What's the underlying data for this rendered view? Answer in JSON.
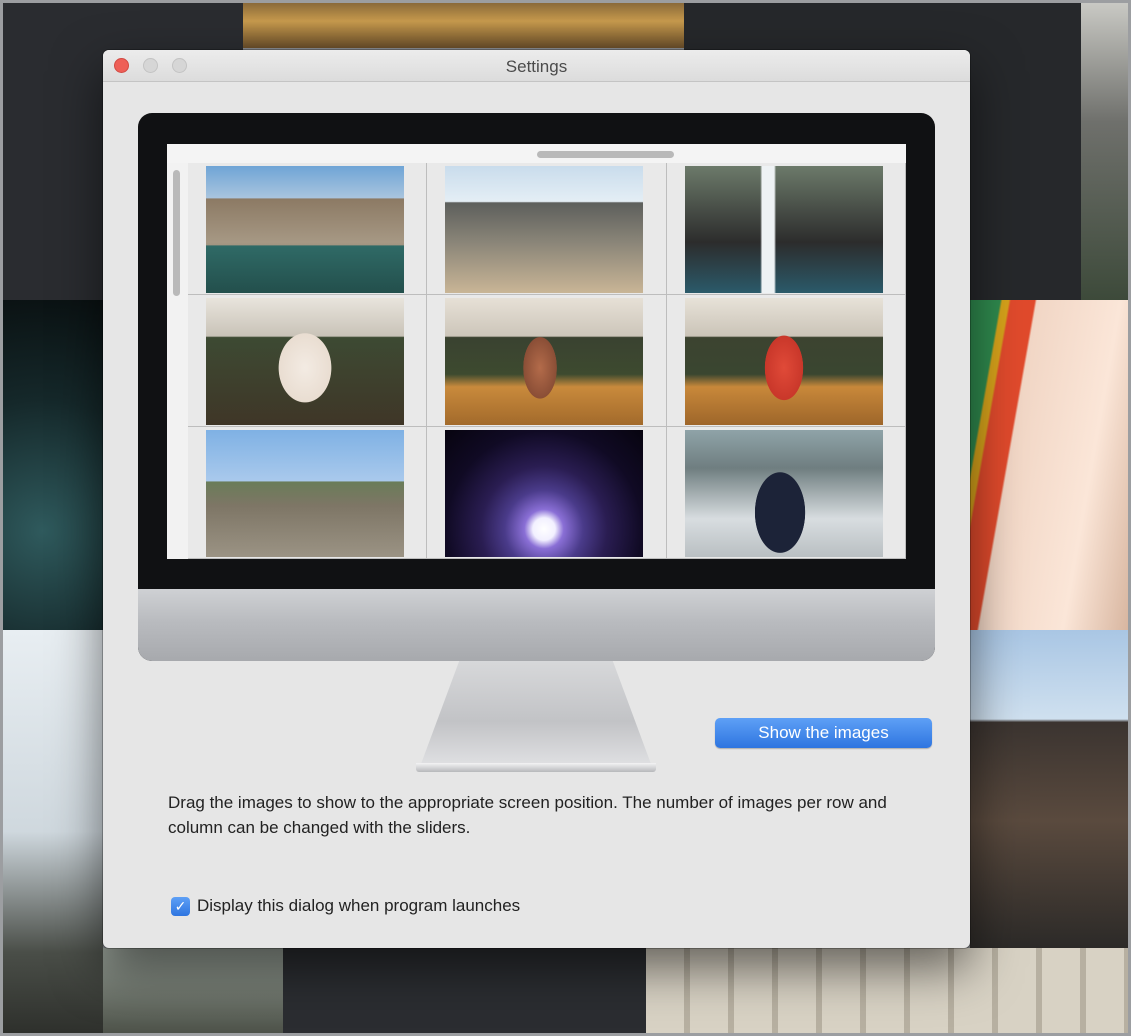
{
  "window": {
    "title": "Settings"
  },
  "preview": {
    "thumbnails": [
      {
        "icon": "bridge-photo"
      },
      {
        "icon": "rocky-shore-photo"
      },
      {
        "icon": "waterfall-photo"
      },
      {
        "icon": "noh-performer-photo"
      },
      {
        "icon": "noh-dancer-photo"
      },
      {
        "icon": "red-costume-performer-photo"
      },
      {
        "icon": "railway-tracks-photo"
      },
      {
        "icon": "light-tunnel-photo"
      },
      {
        "icon": "train-conductor-photo"
      }
    ]
  },
  "actions": {
    "show_images_label": "Show the images"
  },
  "help": {
    "description": "Drag the images to show to the appropriate screen position. The number of images per row and column can be changed with the sliders."
  },
  "options": {
    "display_on_launch_label": "Display this dialog when program launches",
    "display_on_launch_checked": true
  },
  "colors": {
    "accent": "#2e75e0",
    "close_button": "#ee5f57"
  }
}
